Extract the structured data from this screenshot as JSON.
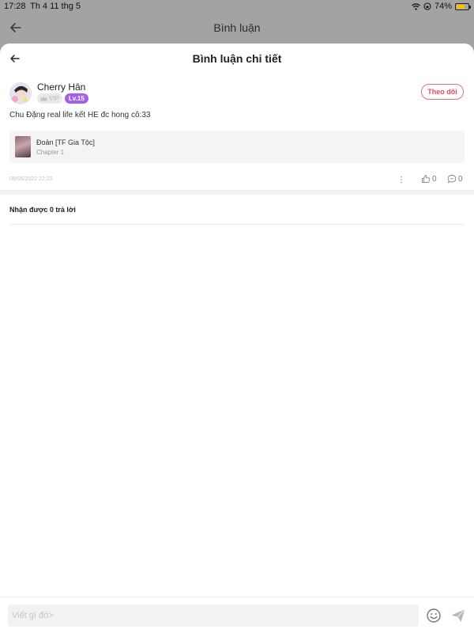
{
  "status_bar": {
    "time": "17:28",
    "date": "Th 4 11 thg 5",
    "battery": "74%",
    "battery_level": 0.74
  },
  "background_screen": {
    "title": "Bình luận"
  },
  "sheet": {
    "title": "Bình luận chi tiết"
  },
  "comment": {
    "username": "Cherry Hân",
    "vip_label": "VIP",
    "level_label": "Lv.15",
    "follow_label": "Theo dõi",
    "text": "Chu Đặng real life kết HE đc hong cô:33",
    "story": {
      "title": "Đoản [TF Gia Tộc]",
      "chapter": "Chapter 1"
    },
    "timestamp": "09/05/2022 22:23",
    "likes": "0",
    "replies": "0"
  },
  "replies_section": {
    "label": "Nhận được 0 trả lời"
  },
  "input": {
    "placeholder": "Viết gì đó>"
  },
  "colors": {
    "accent": "#e84a60",
    "level_badge": "#a461e8",
    "dim_overlay": "#a3a3a3",
    "battery": "#f3c300"
  },
  "icons": {
    "back": "back-arrow-icon",
    "more": "more-dots-icon",
    "like": "thumbs-up-icon",
    "reply": "comment-bubble-icon",
    "emoji": "smiley-icon",
    "send": "send-plane-icon",
    "wifi": "wifi-icon",
    "lock": "orientation-lock-icon",
    "crown": "crown-icon"
  }
}
